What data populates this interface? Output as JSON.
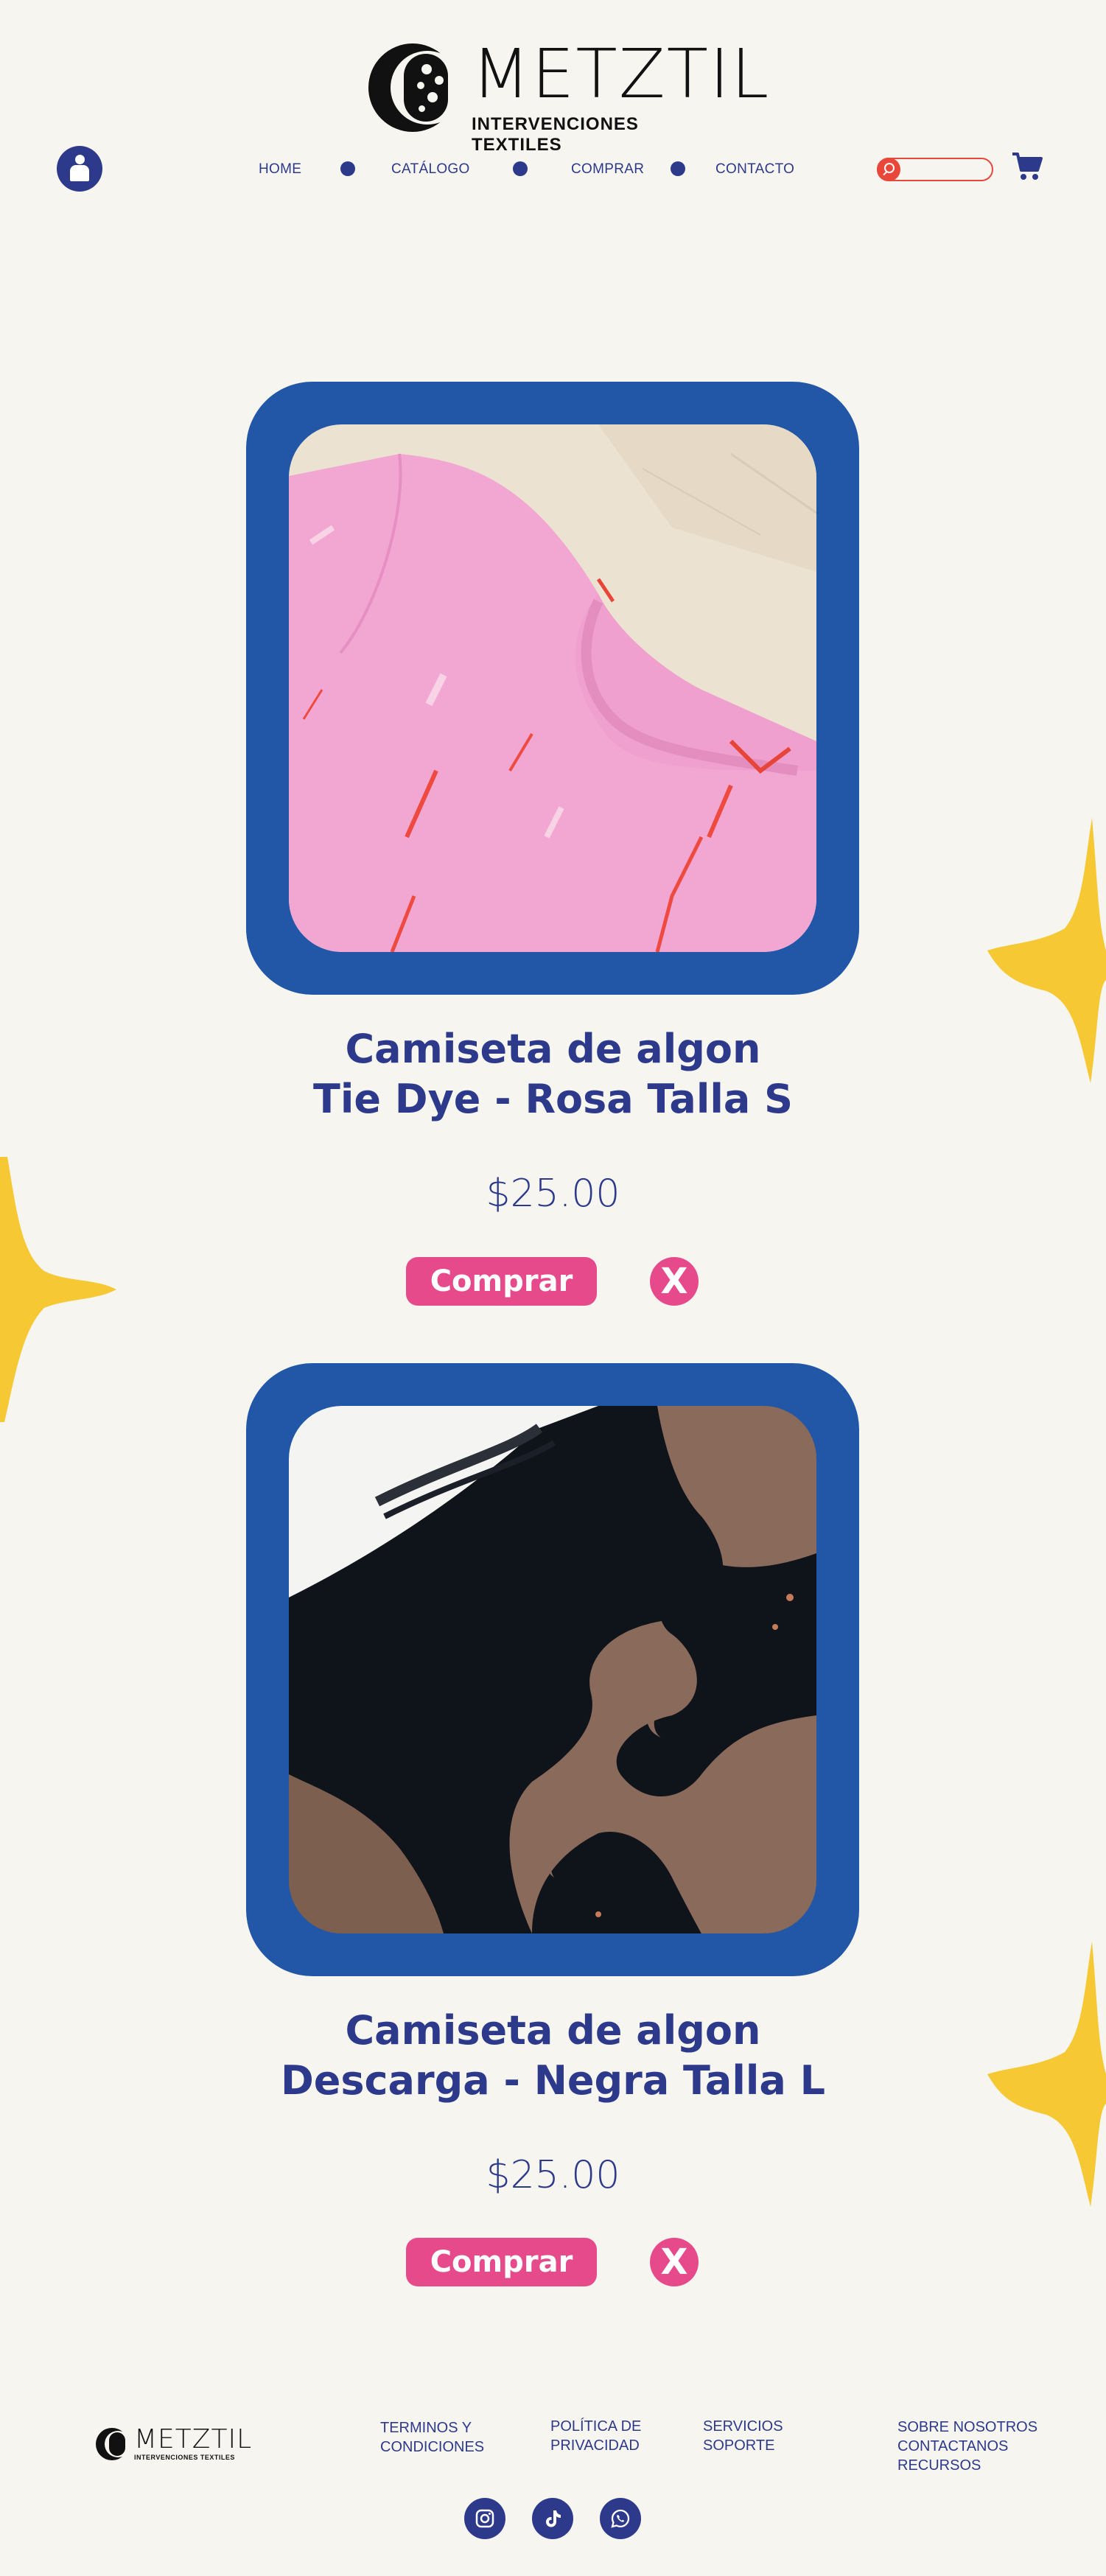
{
  "brand": {
    "name": "METZTIL",
    "tagline": "INTERVENCIONES TEXTILES"
  },
  "nav": {
    "items": [
      {
        "label": "HOME"
      },
      {
        "label": "CATÁLOGO"
      },
      {
        "label": "COMPRAR"
      },
      {
        "label": "CONTACTO"
      }
    ]
  },
  "search": {
    "placeholder": "",
    "value": ""
  },
  "products": [
    {
      "title_line1": "Camiseta de algon",
      "title_line2": "Tie Dye - Rosa Talla S",
      "price": "$25.00",
      "buy_label": "Comprar",
      "remove_label": "X"
    },
    {
      "title_line1": "Camiseta de algon",
      "title_line2": "Descarga - Negra Talla L",
      "price": "$25.00",
      "buy_label": "Comprar",
      "remove_label": "X"
    }
  ],
  "footer": {
    "brand_name": "METZTIL",
    "brand_tagline": "INTERVENCIONES TEXTILES",
    "columns": [
      [
        "TERMINOS Y",
        "CONDICIONES"
      ],
      [
        "POLÍTICA DE",
        "PRIVACIDAD"
      ],
      [
        "SERVICIOS",
        "SOPORTE"
      ],
      [
        "SOBRE NOSOTROS",
        "CONTACTANOS",
        "RECURSOS"
      ]
    ],
    "social": [
      "instagram-icon",
      "tiktok-icon",
      "whatsapp-icon"
    ]
  },
  "colors": {
    "background": "#f6f5ef",
    "primary": "#2d3a8c",
    "frame": "#2257a8",
    "accent_pink": "#e64a8a",
    "search_red": "#e8473a",
    "star_yellow": "#f5c834"
  }
}
